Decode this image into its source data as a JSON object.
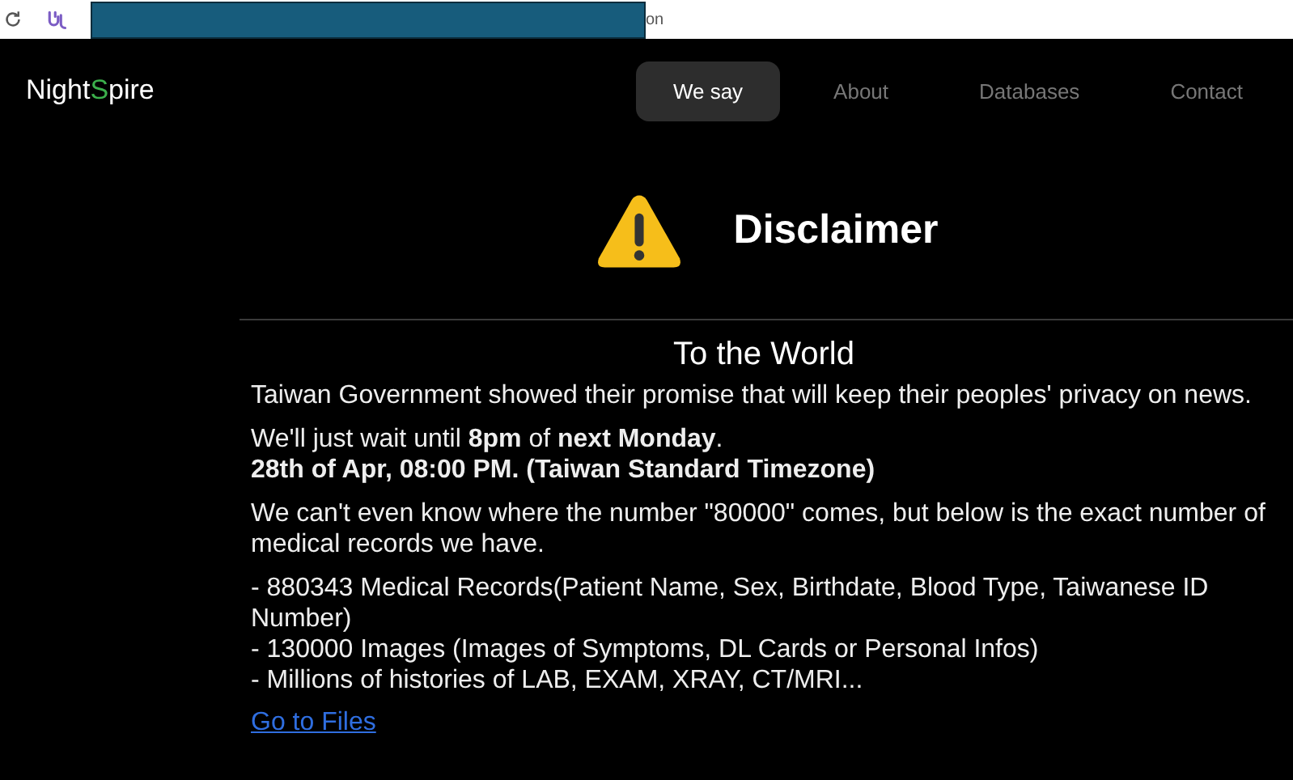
{
  "browser_bar": {
    "address_fragment": "on",
    "redacted": true
  },
  "logo": {
    "parts": [
      {
        "text": "Night",
        "color": "#ffffff"
      },
      {
        "text": "S",
        "color": "#3cb04c"
      },
      {
        "text": "pire",
        "color": "#ffffff"
      }
    ]
  },
  "nav": [
    {
      "label": "We say",
      "selected": true
    },
    {
      "label": "About",
      "selected": false
    },
    {
      "label": "Databases",
      "selected": false
    },
    {
      "label": "Contact",
      "selected": false
    }
  ],
  "header": {
    "title": "Disclaimer"
  },
  "article": {
    "title": "To the World",
    "paragraphs": [
      {
        "lines": [
          "Taiwan Government showed their promise that will keep their peoples' privacy on news."
        ]
      },
      {
        "lines": [
          "We'll just wait until **8pm** of **next Monday**.",
          "**28th of Apr, 08:00 PM. (Taiwan Standard Timezone)**"
        ]
      },
      {
        "lines": [
          "We can't even know where the number \"80000\" comes, but below is the exact number of medical records we have."
        ]
      },
      {
        "lines": [
          "- 880343 Medical Records(Patient Name, Sex, Birthdate, Blood Type, Taiwanese ID Number)",
          "- 130000 Images (Images of Symptoms, DL Cards or Personal Infos)",
          "- Millions of histories of LAB, EXAM, XRAY, CT/MRI..."
        ]
      }
    ],
    "link": "Go to Files"
  }
}
